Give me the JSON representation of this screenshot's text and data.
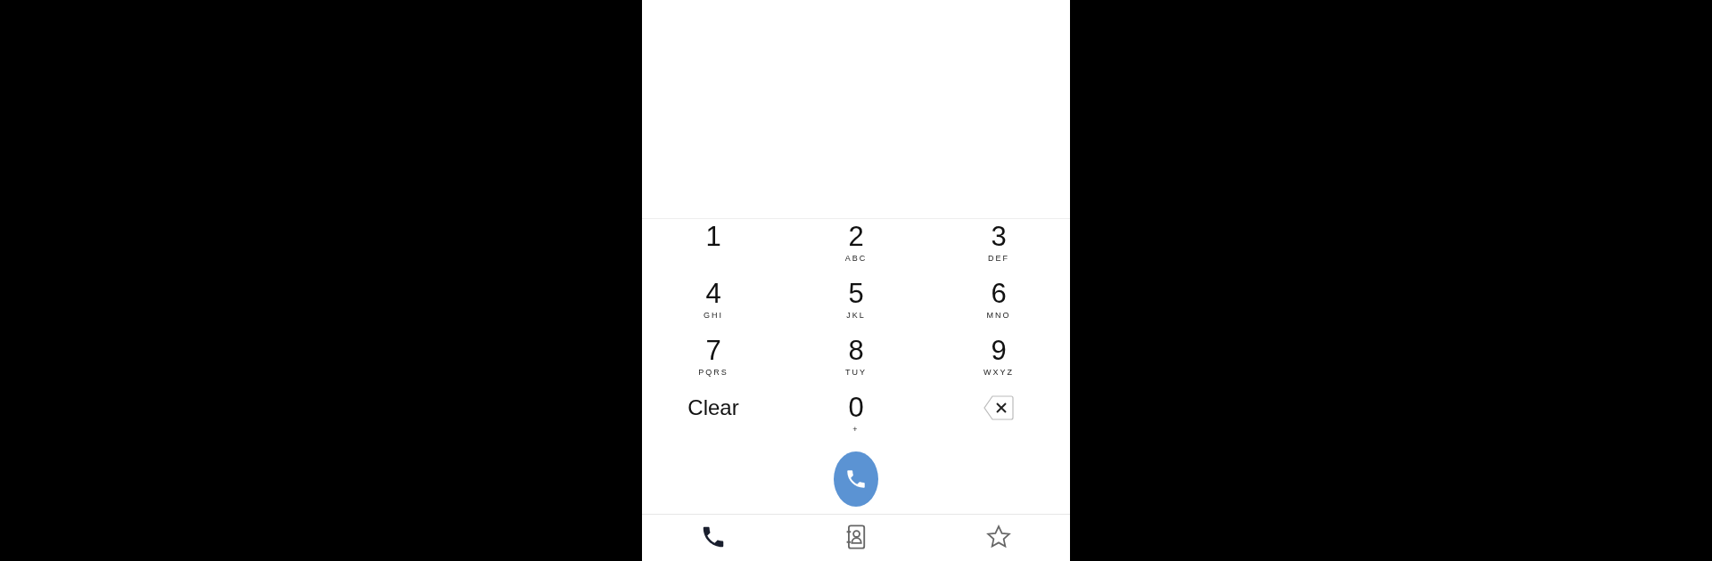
{
  "keypad": [
    {
      "kind": "digit",
      "digit": "1"
    },
    {
      "kind": "digit",
      "digit": "2",
      "letters": "ABC"
    },
    {
      "kind": "digit",
      "digit": "3",
      "letters": "DEF"
    },
    {
      "kind": "digit",
      "digit": "4",
      "letters": "GHI"
    },
    {
      "kind": "digit",
      "digit": "5",
      "letters": "JKL"
    },
    {
      "kind": "digit",
      "digit": "6",
      "letters": "MNO"
    },
    {
      "kind": "digit",
      "digit": "7",
      "letters": "PQRS"
    },
    {
      "kind": "digit",
      "digit": "8",
      "letters": "TUY"
    },
    {
      "kind": "digit",
      "digit": "9",
      "letters": "WXYZ"
    },
    {
      "kind": "text",
      "label": "Clear"
    },
    {
      "kind": "digit",
      "digit": "0",
      "letters": "+"
    },
    {
      "kind": "backspace"
    }
  ],
  "tabs": [
    {
      "kind": "phone",
      "selected": true
    },
    {
      "kind": "contacts",
      "selected": false
    },
    {
      "kind": "star",
      "selected": false
    }
  ]
}
